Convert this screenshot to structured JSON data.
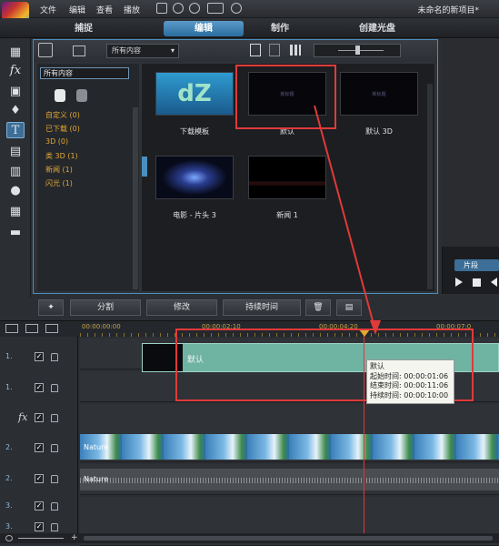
{
  "menu": [
    "文件",
    "编辑",
    "查看",
    "播放"
  ],
  "project_title": "未命名的新项目*",
  "mode_tabs": [
    "捕捉",
    "编辑",
    "制作",
    "创建光盘"
  ],
  "library": {
    "category_select": "所有内容",
    "tree_header": "所有内容",
    "tree_items": [
      "自定义 (0)",
      "已下载 (0)",
      "3D (0)",
      "类 3D (1)",
      "新闻 (1)",
      "闪光 (1)"
    ],
    "thumbs": [
      {
        "label": "下载模板",
        "text": "dZ"
      },
      {
        "label": "默认",
        "text": "新标题"
      },
      {
        "label": "默认 3D",
        "text": "新标题"
      },
      {
        "label": "电影 - 片头 3",
        "text": ""
      },
      {
        "label": "新闻 1",
        "text": ""
      }
    ]
  },
  "preview": {
    "segment_tab": "片段"
  },
  "edit_toolbar": {
    "split": "分割",
    "modify": "修改",
    "duration": "持续时间"
  },
  "timeline": {
    "ruler": [
      "00:00:00:00",
      "00:00:02:10",
      "00:00:04:20",
      "00:00:07:0"
    ],
    "tracks": [
      {
        "id": "1.",
        "type": "video"
      },
      {
        "id": "1.",
        "type": "audio"
      },
      {
        "id": "fx",
        "type": "fx"
      },
      {
        "id": "2.",
        "type": "video"
      },
      {
        "id": "2.",
        "type": "audio"
      },
      {
        "id": "3.",
        "type": "video"
      },
      {
        "id": "3.",
        "type": "video"
      }
    ],
    "clip_default_label": "默认",
    "clip_video_label": "Nature",
    "clip_audio_label": "Nature",
    "tooltip": {
      "title": "默认",
      "start": "起始时间: 00:00:01:06",
      "end": "结束时间: 00:00:11:06",
      "duration": "持续时间: 00:00:10:00"
    }
  },
  "colors": {
    "accent": "#4a8fc0",
    "annotation": "#e03a3a",
    "clip_title": "#6fb3a3"
  }
}
